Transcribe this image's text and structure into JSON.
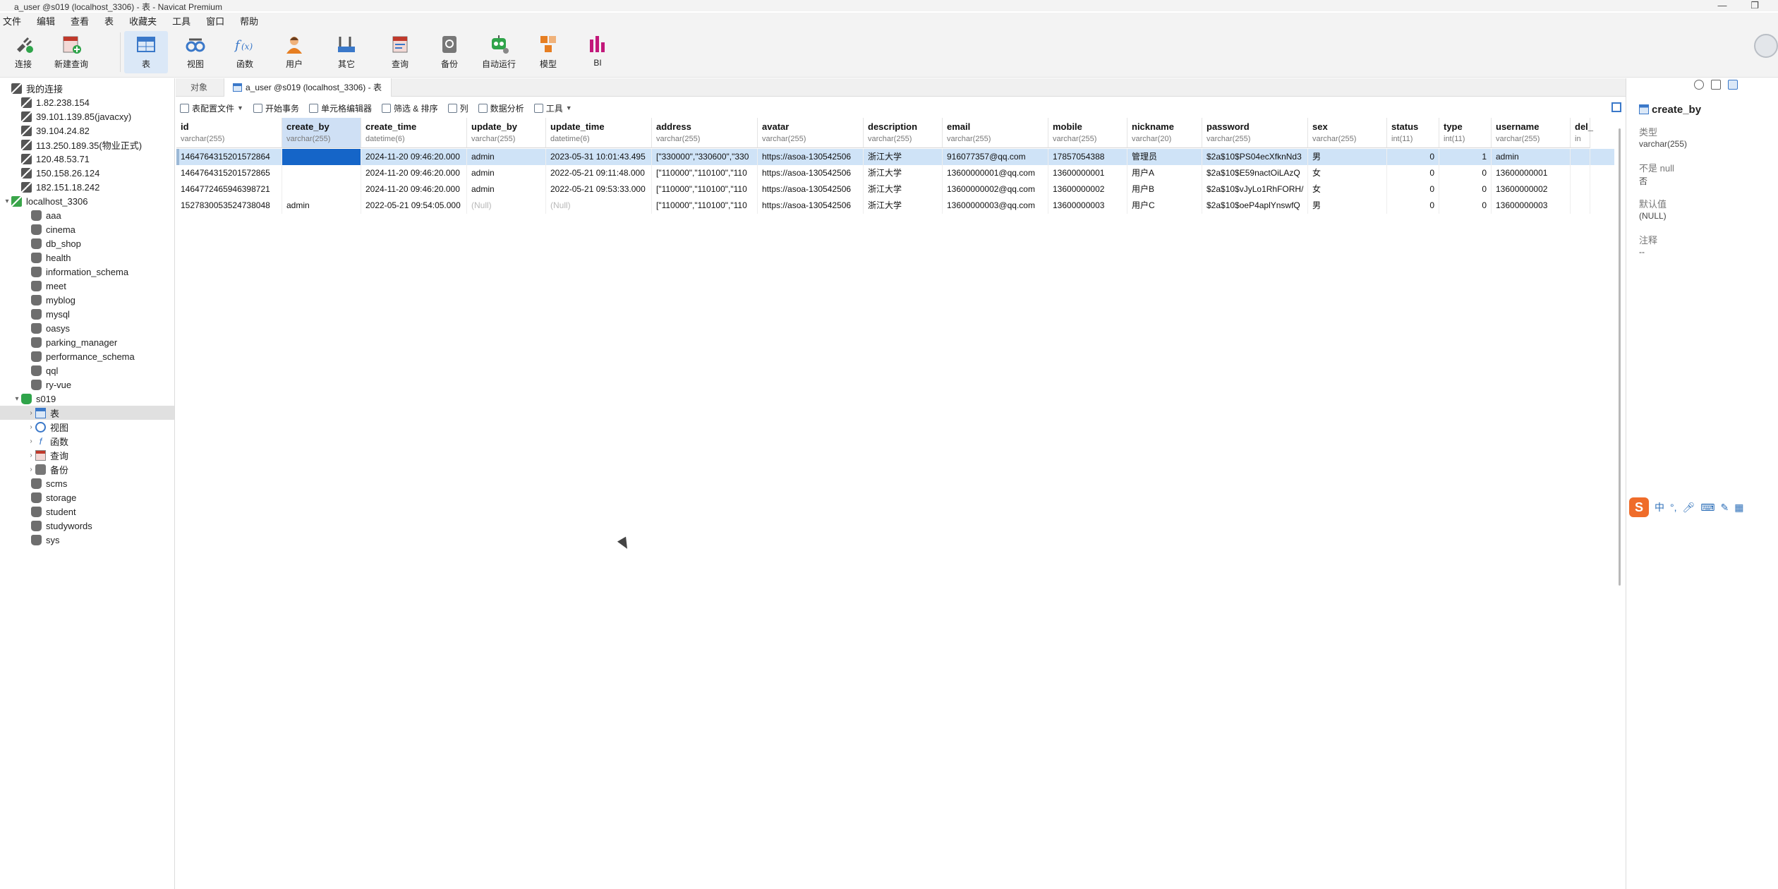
{
  "window": {
    "title": "a_user @s019 (localhost_3306) - 表 - Navicat Premium",
    "minimize_glyph": "—",
    "restore_glyph": "❐"
  },
  "menu": [
    "文件",
    "编辑",
    "查看",
    "表",
    "收藏夹",
    "工具",
    "窗口",
    "帮助"
  ],
  "toolbar": {
    "buttons": [
      {
        "label": "连接",
        "icon": "plug-icon"
      },
      {
        "label": "新建查询",
        "icon": "new-query-icon"
      },
      {
        "label": "表",
        "icon": "table-icon"
      },
      {
        "label": "视图",
        "icon": "view-icon"
      },
      {
        "label": "函数",
        "icon": "function-icon"
      },
      {
        "label": "用户",
        "icon": "user-icon"
      },
      {
        "label": "其它",
        "icon": "other-tools-icon"
      },
      {
        "label": "查询",
        "icon": "query-icon"
      },
      {
        "label": "备份",
        "icon": "backup-icon"
      },
      {
        "label": "自动运行",
        "icon": "robot-icon"
      },
      {
        "label": "模型",
        "icon": "model-icon"
      },
      {
        "label": "BI",
        "icon": "bi-chart-icon"
      }
    ],
    "active": "表"
  },
  "sidebar": {
    "root": "我的连接",
    "connections": [
      "1.82.238.154",
      "39.101.139.85(javacxy)",
      "39.104.24.82",
      "113.250.189.35(物业正式)",
      "120.48.53.71",
      "150.158.26.124",
      "182.151.18.242"
    ],
    "open_connection": "localhost_3306",
    "databases_before": [
      "aaa",
      "cinema",
      "db_shop",
      "health",
      "information_schema",
      "meet",
      "myblog",
      "mysql",
      "oasys",
      "parking_manager",
      "performance_schema",
      "qql",
      "ry-vue"
    ],
    "open_database": "s019",
    "db_children": [
      "表",
      "视图",
      "函数",
      "查询",
      "备份"
    ],
    "databases_after": [
      "scms",
      "storage",
      "student",
      "studywords",
      "sys"
    ]
  },
  "tabs": {
    "objects": "对象",
    "active": "a_user @s019 (localhost_3306) - 表"
  },
  "table_toolbar": {
    "profile": "表配置文件",
    "begin_tx": "开始事务",
    "cell_editor": "单元格编辑器",
    "filter_sort": "筛选 & 排序",
    "columns": "列",
    "analysis": "数据分析",
    "tools": "工具"
  },
  "grid": {
    "columns": [
      {
        "name": "id",
        "type": "varchar(255)"
      },
      {
        "name": "create_by",
        "type": "varchar(255)"
      },
      {
        "name": "create_time",
        "type": "datetime(6)"
      },
      {
        "name": "update_by",
        "type": "varchar(255)"
      },
      {
        "name": "update_time",
        "type": "datetime(6)"
      },
      {
        "name": "address",
        "type": "varchar(255)"
      },
      {
        "name": "avatar",
        "type": "varchar(255)"
      },
      {
        "name": "description",
        "type": "varchar(255)"
      },
      {
        "name": "email",
        "type": "varchar(255)"
      },
      {
        "name": "mobile",
        "type": "varchar(255)"
      },
      {
        "name": "nickname",
        "type": "varchar(20)"
      },
      {
        "name": "password",
        "type": "varchar(255)"
      },
      {
        "name": "sex",
        "type": "varchar(255)"
      },
      {
        "name": "status",
        "type": "int(11)"
      },
      {
        "name": "type",
        "type": "int(11)"
      },
      {
        "name": "username",
        "type": "varchar(255)"
      },
      {
        "name": "del_",
        "type": "in"
      }
    ],
    "rows": [
      [
        "1464764315201572864",
        "",
        "2024-11-20 09:46:20.000",
        "admin",
        "2023-05-31 10:01:43.495",
        "[\"330000\",\"330600\",\"330",
        "https://asoa-130542506",
        "浙江大学",
        "916077357@qq.com",
        "17857054388",
        "管理员",
        "$2a$10$PS04ecXfknNd3",
        "男",
        "0",
        "1",
        "admin",
        ""
      ],
      [
        "1464764315201572865",
        "",
        "2024-11-20 09:46:20.000",
        "admin",
        "2022-05-21 09:11:48.000",
        "[\"110000\",\"110100\",\"110",
        "https://asoa-130542506",
        "浙江大学",
        "13600000001@qq.com",
        "13600000001",
        "用户A",
        "$2a$10$E59nactOiLAzQ",
        "女",
        "0",
        "0",
        "13600000001",
        ""
      ],
      [
        "1464772465946398721",
        "",
        "2024-11-20 09:46:20.000",
        "admin",
        "2022-05-21 09:53:33.000",
        "[\"110000\",\"110100\",\"110",
        "https://asoa-130542506",
        "浙江大学",
        "13600000002@qq.com",
        "13600000002",
        "用户B",
        "$2a$10$vJyLo1RhFORH/",
        "女",
        "0",
        "0",
        "13600000002",
        ""
      ],
      [
        "1527830053524738048",
        "admin",
        "2022-05-21 09:54:05.000",
        "(Null)",
        "(Null)",
        "[\"110000\",\"110100\",\"110",
        "https://asoa-130542506",
        "浙江大学",
        "13600000003@qq.com",
        "13600000003",
        "用户C",
        "$2a$10$oeP4aplYnswfQ",
        "男",
        "0",
        "0",
        "13600000003",
        ""
      ]
    ]
  },
  "right_panel": {
    "field": "create_by",
    "type_label": "类型",
    "type_value": "varchar(255)",
    "notnull_label": "不是 null",
    "notnull_value": "否",
    "default_label": "默认值",
    "default_value": "(NULL)",
    "comment_label": "注释",
    "comment_value": "--"
  },
  "ime": {
    "logo": "S",
    "mode": "中",
    "punct": "°,"
  },
  "colors": {
    "selection": "#cfe3f7",
    "focus_cell": "#1565c8",
    "accent": "#3a78c9"
  }
}
